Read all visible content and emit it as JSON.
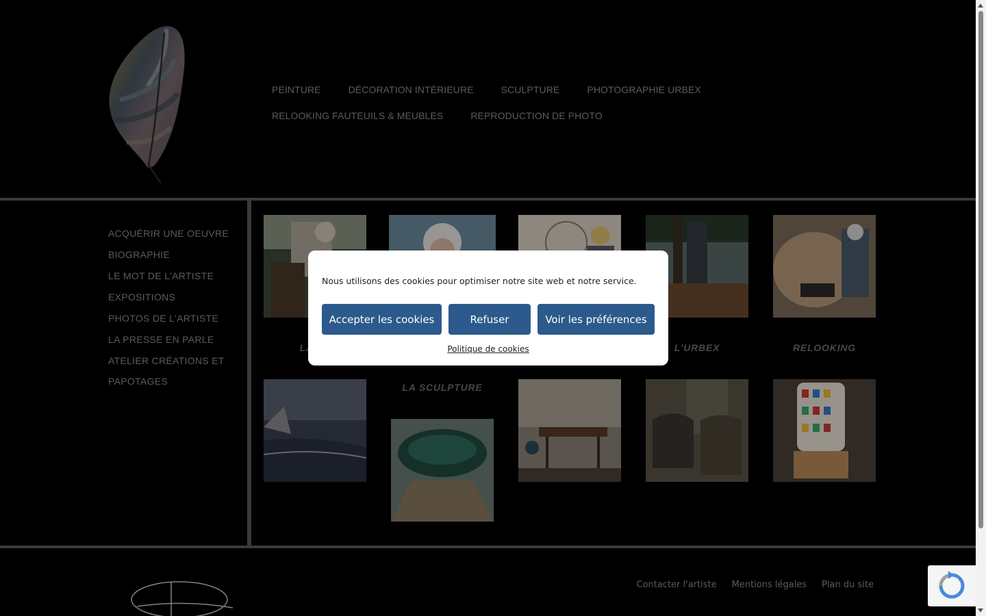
{
  "top_nav": {
    "row1": [
      "PEINTURE",
      "DÉCORATION INTÉRIEURE",
      "SCULPTURE",
      "PHOTOGRAPHIE URBEX"
    ],
    "row2": [
      "RELOOKING FAUTEUILS & MEUBLES",
      "REPRODUCTION DE PHOTO"
    ]
  },
  "sidebar": {
    "items": [
      {
        "label": "ACQUÉRIR UNE OEUVRE"
      },
      {
        "label": "BIOGRAPHIE"
      },
      {
        "label": "LE MOT DE L'ARTISTE"
      },
      {
        "label": "EXPOSITIONS"
      },
      {
        "label": "PHOTOS DE L'ARTISTE"
      },
      {
        "label": "LA PRESSE EN PARLE"
      },
      {
        "label": "ATELIER CRÉATIONS ET"
      },
      {
        "label": "PAPOTAGES"
      }
    ]
  },
  "grid": {
    "captions": {
      "peinture": "LA PE",
      "sculpture": "LA SCULPTURE",
      "urbex": "L'URBEX",
      "relooking": "RELOOKING"
    }
  },
  "footer": {
    "links": [
      "Contacter l'artiste",
      "Mentions légales",
      "Plan du site"
    ]
  },
  "cookie_banner": {
    "message": "Nous utilisons des cookies pour optimiser notre site web et notre service.",
    "accept_label": "Accepter les cookies",
    "refuse_label": "Refuser",
    "preferences_label": "Voir les préférences",
    "policy_label": "Politique de cookies"
  },
  "colors": {
    "background": "#000000",
    "nav_text": "#8c8c8c",
    "separator": "#5a5a5a",
    "button": "#2c5a8c"
  }
}
